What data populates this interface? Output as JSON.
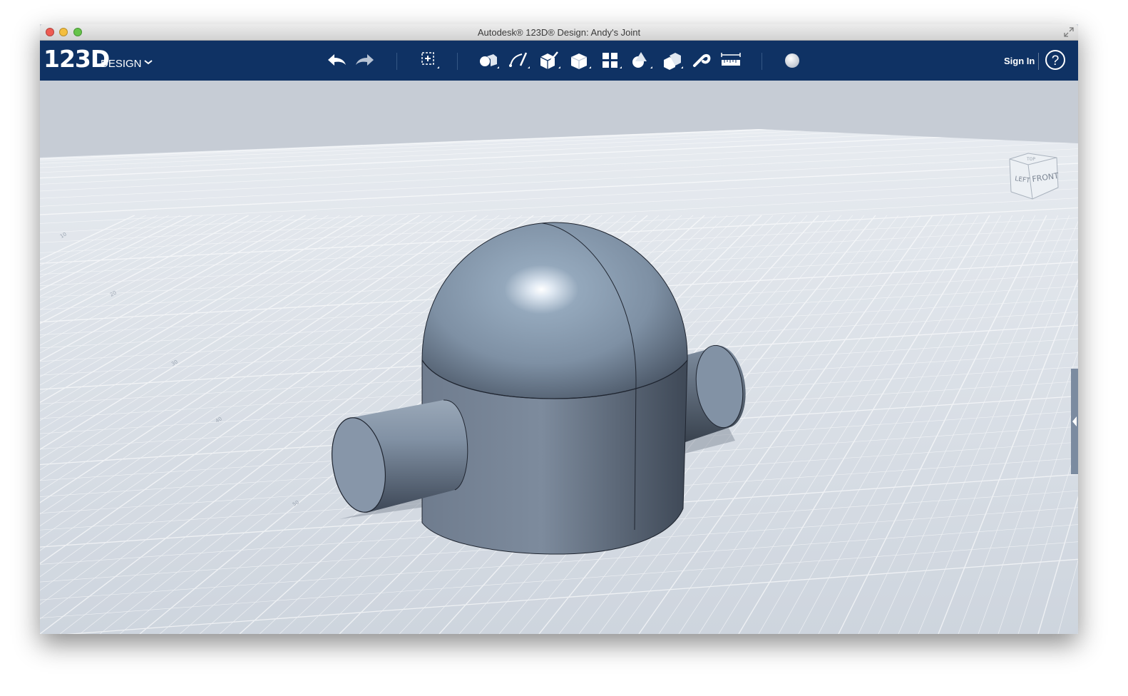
{
  "window": {
    "title": "Autodesk® 123D® Design: Andy's Joint"
  },
  "header": {
    "logo_main": "123D",
    "logo_sub": "DESIGN",
    "sign_in": "Sign In",
    "help_symbol": "?"
  },
  "toolbar": {
    "tools": [
      "undo-icon",
      "redo-icon",
      "transform-icon",
      "primitives-icon",
      "sketch-icon",
      "construct-icon",
      "modify-icon",
      "pattern-icon",
      "grouping-icon",
      "combine-icon",
      "snap-icon",
      "measure-icon",
      "material-icon"
    ]
  },
  "viewcube": {
    "left": "LEFT",
    "front": "FRONT",
    "top": "TOP"
  },
  "grid": {
    "labels": [
      "10",
      "20",
      "30",
      "40",
      "50"
    ]
  },
  "colors": {
    "toolbar": "#0f3264",
    "viewport": "#c6ccd5",
    "model": "#6f7f93"
  }
}
